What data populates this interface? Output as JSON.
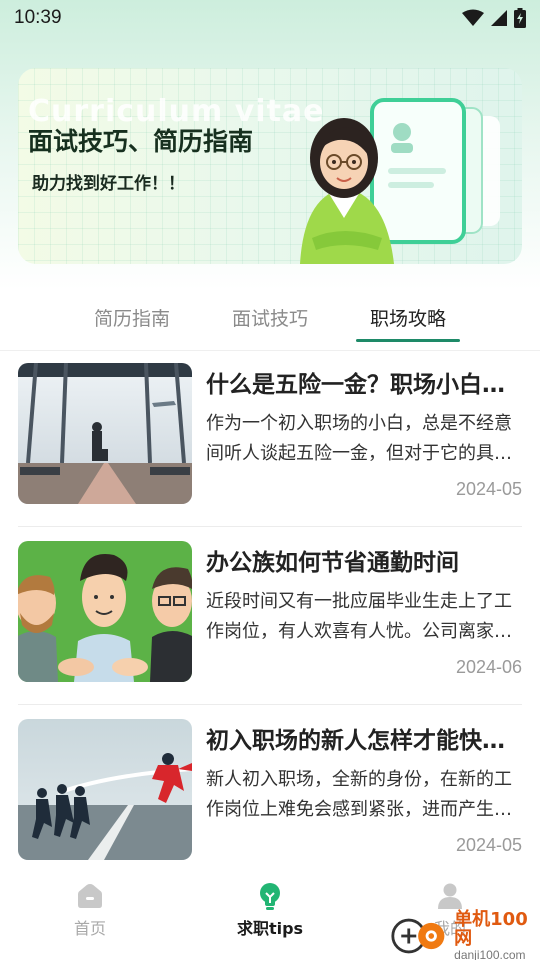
{
  "status_bar": {
    "time": "10:39"
  },
  "banner": {
    "watermark": "Curriculum vitae",
    "title": "面试技巧、简历指南",
    "subtitle": "助力找到好工作！！"
  },
  "tabs": [
    {
      "label": "简历指南",
      "active": false
    },
    {
      "label": "面试技巧",
      "active": false
    },
    {
      "label": "职场攻略",
      "active": true
    }
  ],
  "articles": [
    {
      "title": "什么是五险一金？职场小白必看",
      "snippet": "作为一个初入职场的小白，总是不经意间听人谈起五险一金，但对于它的具体内容却不甚了解",
      "date": "2024-05"
    },
    {
      "title": "办公族如何节省通勤时间",
      "snippet": "近段时间又有一批应届毕业生走上了工作岗位，有人欢喜有人忧。公司离家远的通勤问题",
      "date": "2024-06"
    },
    {
      "title": "初入职场的新人怎样才能快速适应",
      "snippet": "新人初入职场，全新的身份，在新的工作岗位上难免会感到紧张，进而产生焦虑情绪",
      "date": "2024-05"
    }
  ],
  "bottom_nav": [
    {
      "label": "首页",
      "icon": "home-icon",
      "active": false
    },
    {
      "label": "求职tips",
      "icon": "lightbulb-icon",
      "active": true
    },
    {
      "label": "我的",
      "icon": "user-icon",
      "active": false
    }
  ],
  "site_watermark": {
    "name": "单机100网",
    "url": "danji100.com"
  },
  "colors": {
    "accent": "#1e8a68",
    "active_icon": "#22b573",
    "inactive": "#a9a9a9"
  }
}
